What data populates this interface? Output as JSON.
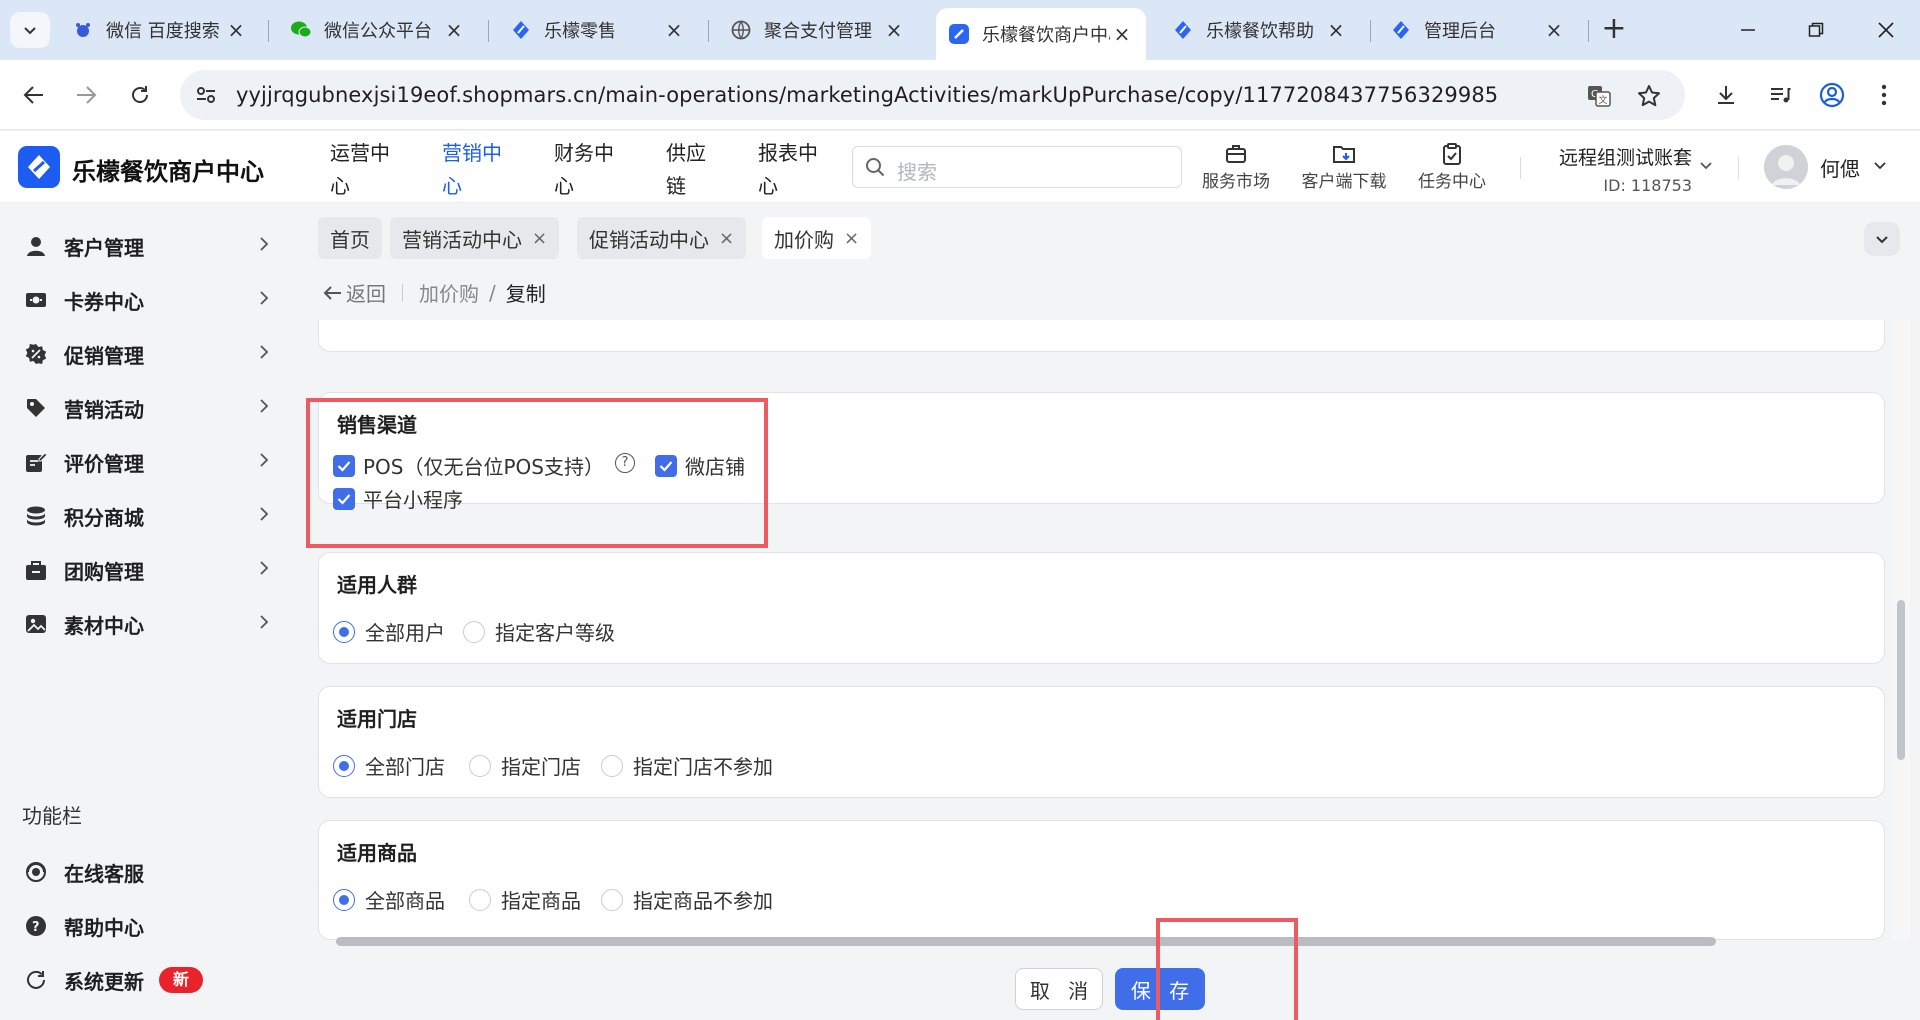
{
  "browser": {
    "tabs": [
      {
        "title": "微信 百度搜索",
        "icon": "baidu-icon"
      },
      {
        "title": "微信公众平台",
        "icon": "wechat-icon"
      },
      {
        "title": "乐檬零售",
        "icon": "lemeng-icon"
      },
      {
        "title": "聚合支付管理",
        "icon": "globe-icon"
      },
      {
        "title": "乐檬餐饮商户中心",
        "icon": "lemeng-icon"
      },
      {
        "title": "乐檬餐饮帮助",
        "icon": "lemeng-icon"
      },
      {
        "title": "管理后台",
        "icon": "lemeng-icon"
      }
    ],
    "active_tab": 4,
    "url": "yyjjrqgubnexjsi19eof.shopmars.cn/main-operations/marketingActivities/markUpPurchase/copy/1177208437756329985"
  },
  "header": {
    "brand": "乐檬餐饮商户中心",
    "nav": [
      {
        "line1": "运营中",
        "line2": "心",
        "active": false
      },
      {
        "line1": "营销中",
        "line2": "心",
        "active": true
      },
      {
        "line1": "财务中",
        "line2": "心",
        "active": false
      },
      {
        "line1": "供应",
        "line2": "链",
        "active": false
      },
      {
        "line1": "报表中",
        "line2": "心",
        "active": false
      }
    ],
    "search_placeholder": "搜索",
    "tools": [
      "服务市场",
      "客户端下载",
      "任务中心"
    ],
    "account_name": "远程组测试账套",
    "account_id": "ID: 118753",
    "user_name": "何偲"
  },
  "sidebar": {
    "items": [
      {
        "label": "客户管理",
        "icon": "user-icon"
      },
      {
        "label": "卡券中心",
        "icon": "coupon-icon"
      },
      {
        "label": "促销管理",
        "icon": "promo-icon"
      },
      {
        "label": "营销活动",
        "icon": "tag-icon"
      },
      {
        "label": "评价管理",
        "icon": "review-icon"
      },
      {
        "label": "积分商城",
        "icon": "coins-icon"
      },
      {
        "label": "团购管理",
        "icon": "group-buy-icon"
      },
      {
        "label": "素材中心",
        "icon": "image-icon"
      }
    ],
    "function_title": "功能栏",
    "functions": [
      {
        "label": "在线客服",
        "icon": "support-icon"
      },
      {
        "label": "帮助中心",
        "icon": "help-icon"
      },
      {
        "label": "系统更新",
        "icon": "refresh-icon",
        "badge": "新"
      }
    ]
  },
  "page_tabs": [
    {
      "label": "首页",
      "closable": false
    },
    {
      "label": "营销活动中心",
      "closable": true
    },
    {
      "label": "促销活动中心",
      "closable": true
    },
    {
      "label": "加价购",
      "closable": true,
      "active": true
    }
  ],
  "breadcrumb": {
    "back": "返回",
    "parent": "加价购",
    "separator": "/",
    "current": "复制"
  },
  "form": {
    "sales_channel": {
      "title": "销售渠道",
      "options": [
        {
          "label": "POS（仅无台位POS支持）",
          "checked": true
        },
        {
          "label": "微店铺",
          "checked": true
        },
        {
          "label": "平台小程序",
          "checked": true
        }
      ]
    },
    "audience": {
      "title": "适用人群",
      "options": [
        {
          "label": "全部用户",
          "selected": true
        },
        {
          "label": "指定客户等级",
          "selected": false
        }
      ]
    },
    "stores": {
      "title": "适用门店",
      "options": [
        {
          "label": "全部门店",
          "selected": true
        },
        {
          "label": "指定门店",
          "selected": false
        },
        {
          "label": "指定门店不参加",
          "selected": false
        }
      ]
    },
    "products": {
      "title": "适用商品",
      "options": [
        {
          "label": "全部商品",
          "selected": true
        },
        {
          "label": "指定商品",
          "selected": false
        },
        {
          "label": "指定商品不参加",
          "selected": false
        }
      ]
    }
  },
  "footer": {
    "cancel": "取 消",
    "save": "保 存"
  },
  "colors": {
    "primary": "#3f6ee8",
    "brand": "#1d5cf0",
    "highlight": "#ee5a5f",
    "badge": "#e8232c"
  }
}
